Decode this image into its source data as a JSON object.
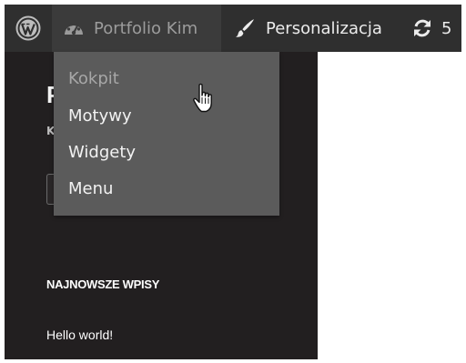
{
  "adminbar": {
    "wp_logo_icon": "wordpress-logo-icon",
    "site_name": "Portfolio Kim",
    "site_icon": "dashboard-gauge-icon",
    "customize_label": "Personalizacja",
    "customize_icon": "paintbrush-icon",
    "updates_count": "5",
    "updates_icon": "refresh-icon"
  },
  "dropdown": {
    "items": [
      "Kokpit",
      "Motywy",
      "Widgety",
      "Menu"
    ]
  },
  "site": {
    "title_peek": "P",
    "description_peek": "K",
    "widget_title": "NAJNOWSZE WPISY",
    "widget_link": "Hello world!"
  },
  "colors": {
    "adminbar_bg": "#2f2f2f",
    "dropdown_bg": "#5b5b5b",
    "site_bg": "#221f20"
  }
}
